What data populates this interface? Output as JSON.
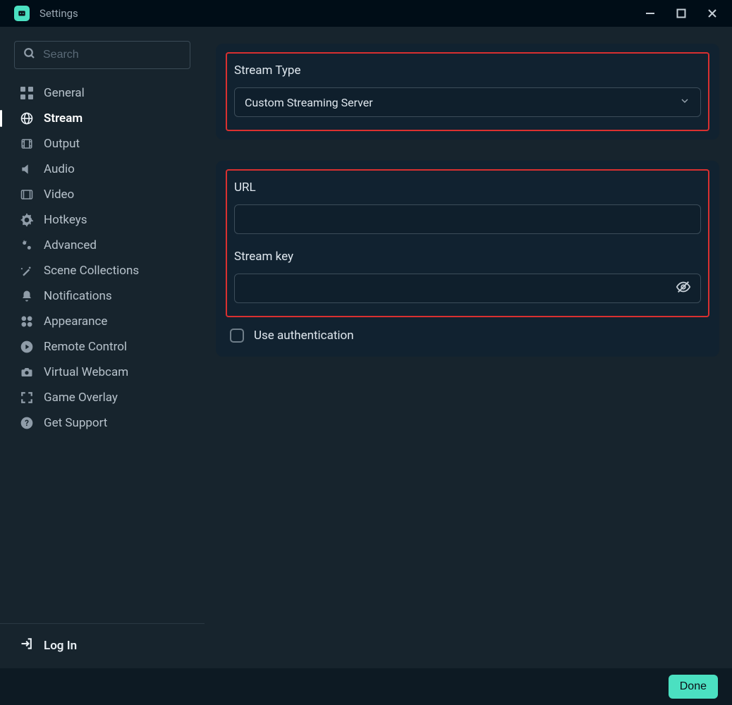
{
  "window": {
    "title": "Settings"
  },
  "search": {
    "placeholder": "Search",
    "value": ""
  },
  "sidebar": {
    "items": [
      {
        "label": "General",
        "active": false
      },
      {
        "label": "Stream",
        "active": true
      },
      {
        "label": "Output",
        "active": false
      },
      {
        "label": "Audio",
        "active": false
      },
      {
        "label": "Video",
        "active": false
      },
      {
        "label": "Hotkeys",
        "active": false
      },
      {
        "label": "Advanced",
        "active": false
      },
      {
        "label": "Scene Collections",
        "active": false
      },
      {
        "label": "Notifications",
        "active": false
      },
      {
        "label": "Appearance",
        "active": false
      },
      {
        "label": "Remote Control",
        "active": false
      },
      {
        "label": "Virtual Webcam",
        "active": false
      },
      {
        "label": "Game Overlay",
        "active": false
      },
      {
        "label": "Get Support",
        "active": false
      }
    ],
    "login": "Log In"
  },
  "stream": {
    "type_label": "Stream Type",
    "type_value": "Custom Streaming Server",
    "url_label": "URL",
    "url_value": "",
    "key_label": "Stream key",
    "key_value": "",
    "use_auth_label": "Use authentication",
    "use_auth_checked": false
  },
  "footer": {
    "done": "Done"
  },
  "colors": {
    "accent": "#4be0c1",
    "highlight": "#d93030",
    "bg": "#17242d",
    "panel": "#112230"
  }
}
